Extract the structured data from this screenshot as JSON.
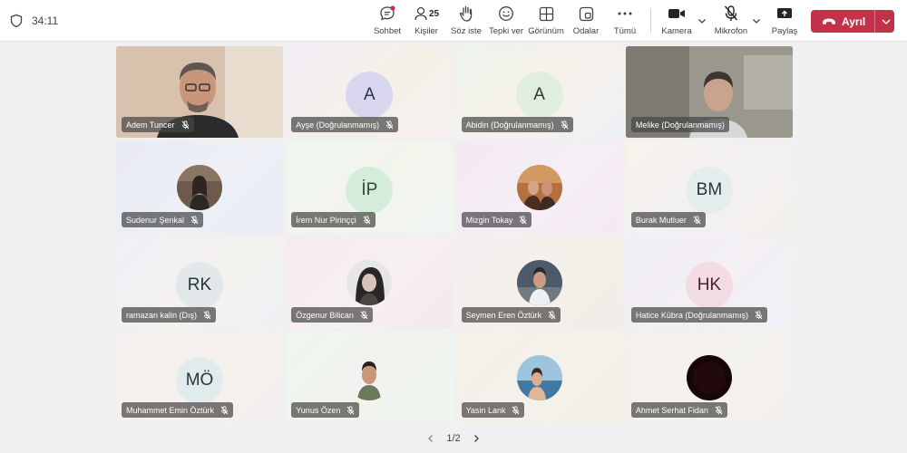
{
  "meeting": {
    "timer": "34:11"
  },
  "toolbar": {
    "chat_label": "Sohbet",
    "people_label": "Kişiler",
    "people_count": "25",
    "raise_label": "Söz iste",
    "react_label": "Tepki ver",
    "view_label": "Görünüm",
    "rooms_label": "Odalar",
    "more_label": "Tümü",
    "camera_label": "Kamera",
    "mic_label": "Mikrofon",
    "share_label": "Paylaş",
    "leave_label": "Ayrıl"
  },
  "colors": {
    "leave": "#c4314b",
    "active_outline": "#5b5fc7"
  },
  "participants": [
    {
      "name": "Adem Tuncer",
      "kind": "video"
    },
    {
      "name": "Ayşe (Doğrulanmamış)",
      "initials": "A",
      "kind": "initials"
    },
    {
      "name": "Abidin (Doğrulanmamış)",
      "initials": "A",
      "kind": "initials"
    },
    {
      "name": "Melike (Doğrulanmamış)",
      "kind": "video"
    },
    {
      "name": "Sudenur Şenkal",
      "kind": "photo"
    },
    {
      "name": "İrem Nur Pirinççi",
      "initials": "İP",
      "kind": "initials"
    },
    {
      "name": "Mizgin Tokay",
      "kind": "photo"
    },
    {
      "name": "Burak Mutluer",
      "initials": "BM",
      "kind": "initials"
    },
    {
      "name": "ramazan kalin (Dış)",
      "initials": "RK",
      "kind": "initials"
    },
    {
      "name": "Özgenur Bilican",
      "kind": "photo"
    },
    {
      "name": "Seymen Eren Öztürk",
      "kind": "photo"
    },
    {
      "name": "Hatice Kübra (Doğrulanmamış)",
      "initials": "HK",
      "kind": "initials"
    },
    {
      "name": "Muhammet Emin Öztürk",
      "initials": "MÖ",
      "kind": "initials"
    },
    {
      "name": "Yunus Özen",
      "kind": "photo"
    },
    {
      "name": "Yasin Lank",
      "kind": "photo"
    },
    {
      "name": "Ahmet Serhat Fidan",
      "kind": "photo"
    }
  ],
  "pager": {
    "label": "1/2"
  }
}
